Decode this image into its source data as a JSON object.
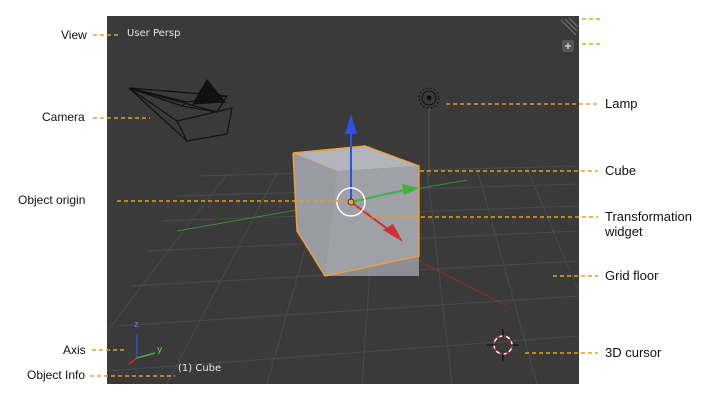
{
  "viewport": {
    "view_name": "User Persp",
    "object_info": "(1) Cube",
    "axis_labels": {
      "z": "z",
      "y": "y"
    }
  },
  "callouts": {
    "view": "View",
    "camera": "Camera",
    "object_origin": "Object origin",
    "axis": "Axis",
    "object_info": "Object Info",
    "lamp": "Lamp",
    "cube": "Cube",
    "transformation_widget": "Transformation widget",
    "grid_floor": "Grid floor",
    "cursor_3d": "3D cursor"
  },
  "colors": {
    "viewport_bg": "#3a3a3a",
    "leader_line": "#e0a020",
    "selection_outline": "#f0a030",
    "axis_x": "#d03030",
    "axis_y": "#40b040",
    "axis_z": "#3050e0"
  }
}
